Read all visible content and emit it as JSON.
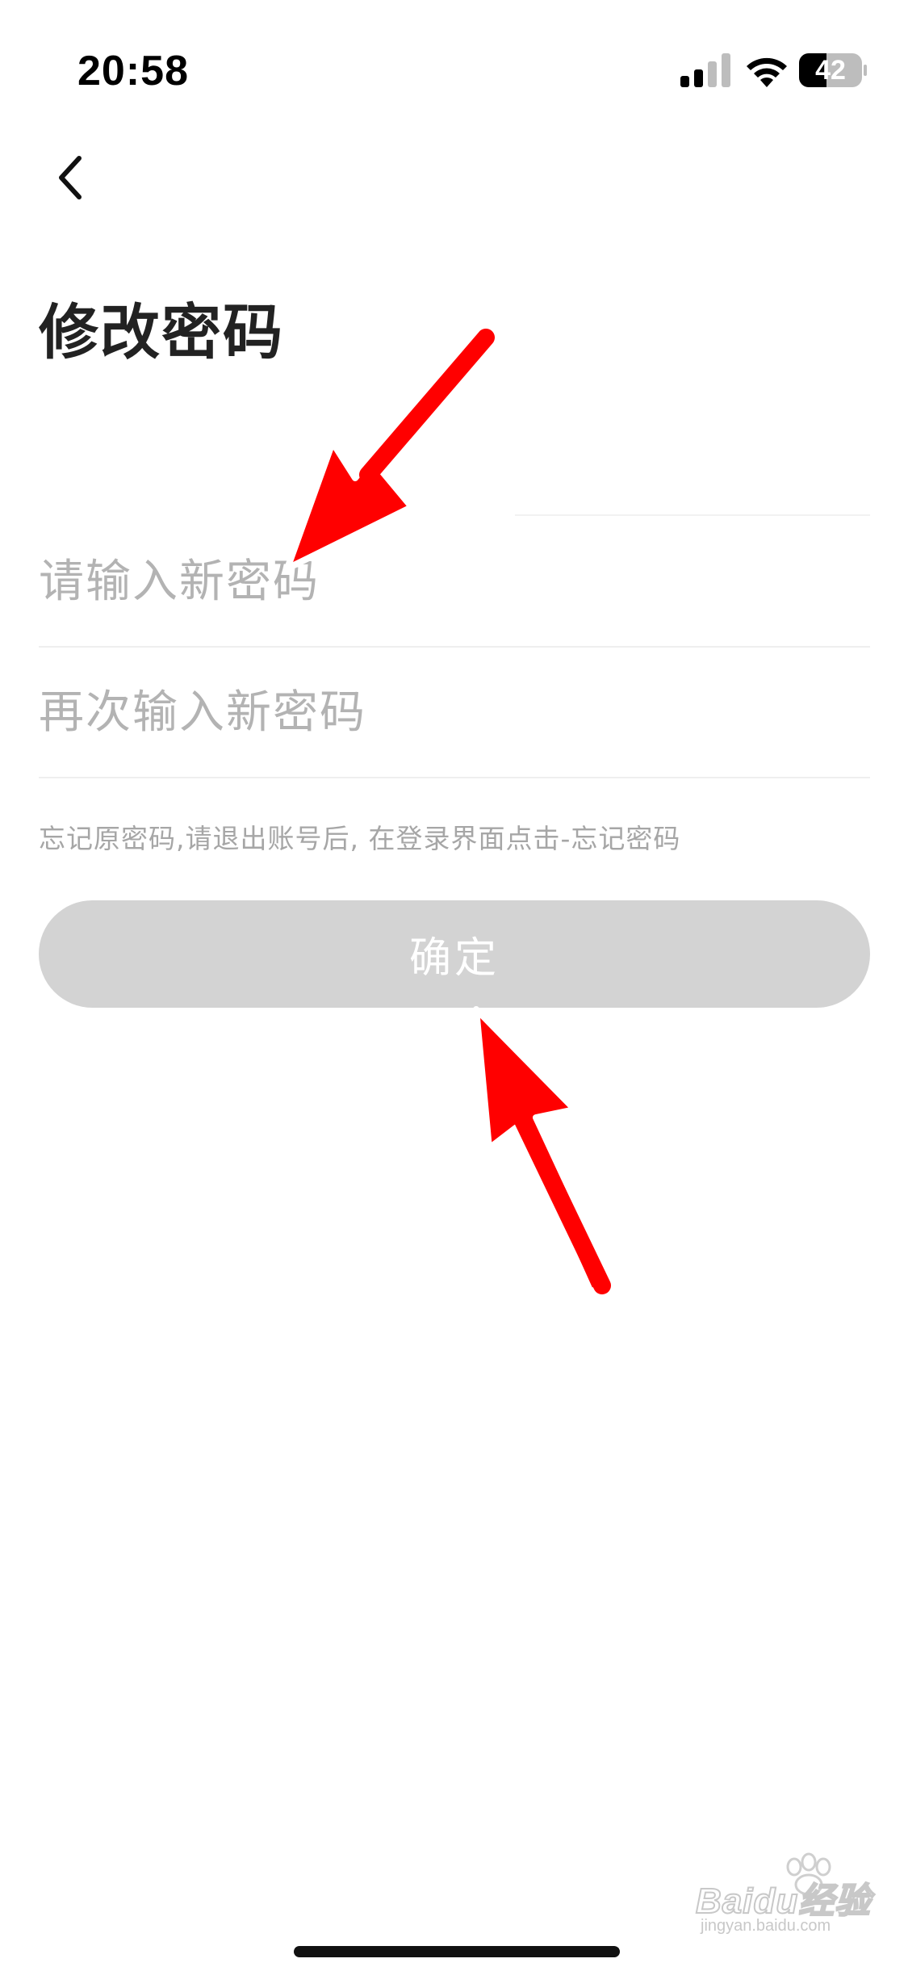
{
  "status_bar": {
    "time": "20:58",
    "battery": "42"
  },
  "header": {
    "back_icon": "chevron-left-icon",
    "title": "修改密码"
  },
  "form": {
    "new_password": {
      "value": "",
      "placeholder": "请输入新密码"
    },
    "confirm_password": {
      "value": "",
      "placeholder": "再次输入新密码"
    },
    "hint": "忘记原密码,请退出账号后, 在登录界面点击-忘记密码",
    "confirm_label": "确定"
  },
  "colors": {
    "title": "#222222",
    "placeholder": "#b3b3b3",
    "hint": "#a6a6a6",
    "button_disabled": "#d3d3d3",
    "arrow": "#ff0000"
  },
  "watermark": {
    "brand": "Baidu经验",
    "site": "jingyan.baidu.com"
  }
}
